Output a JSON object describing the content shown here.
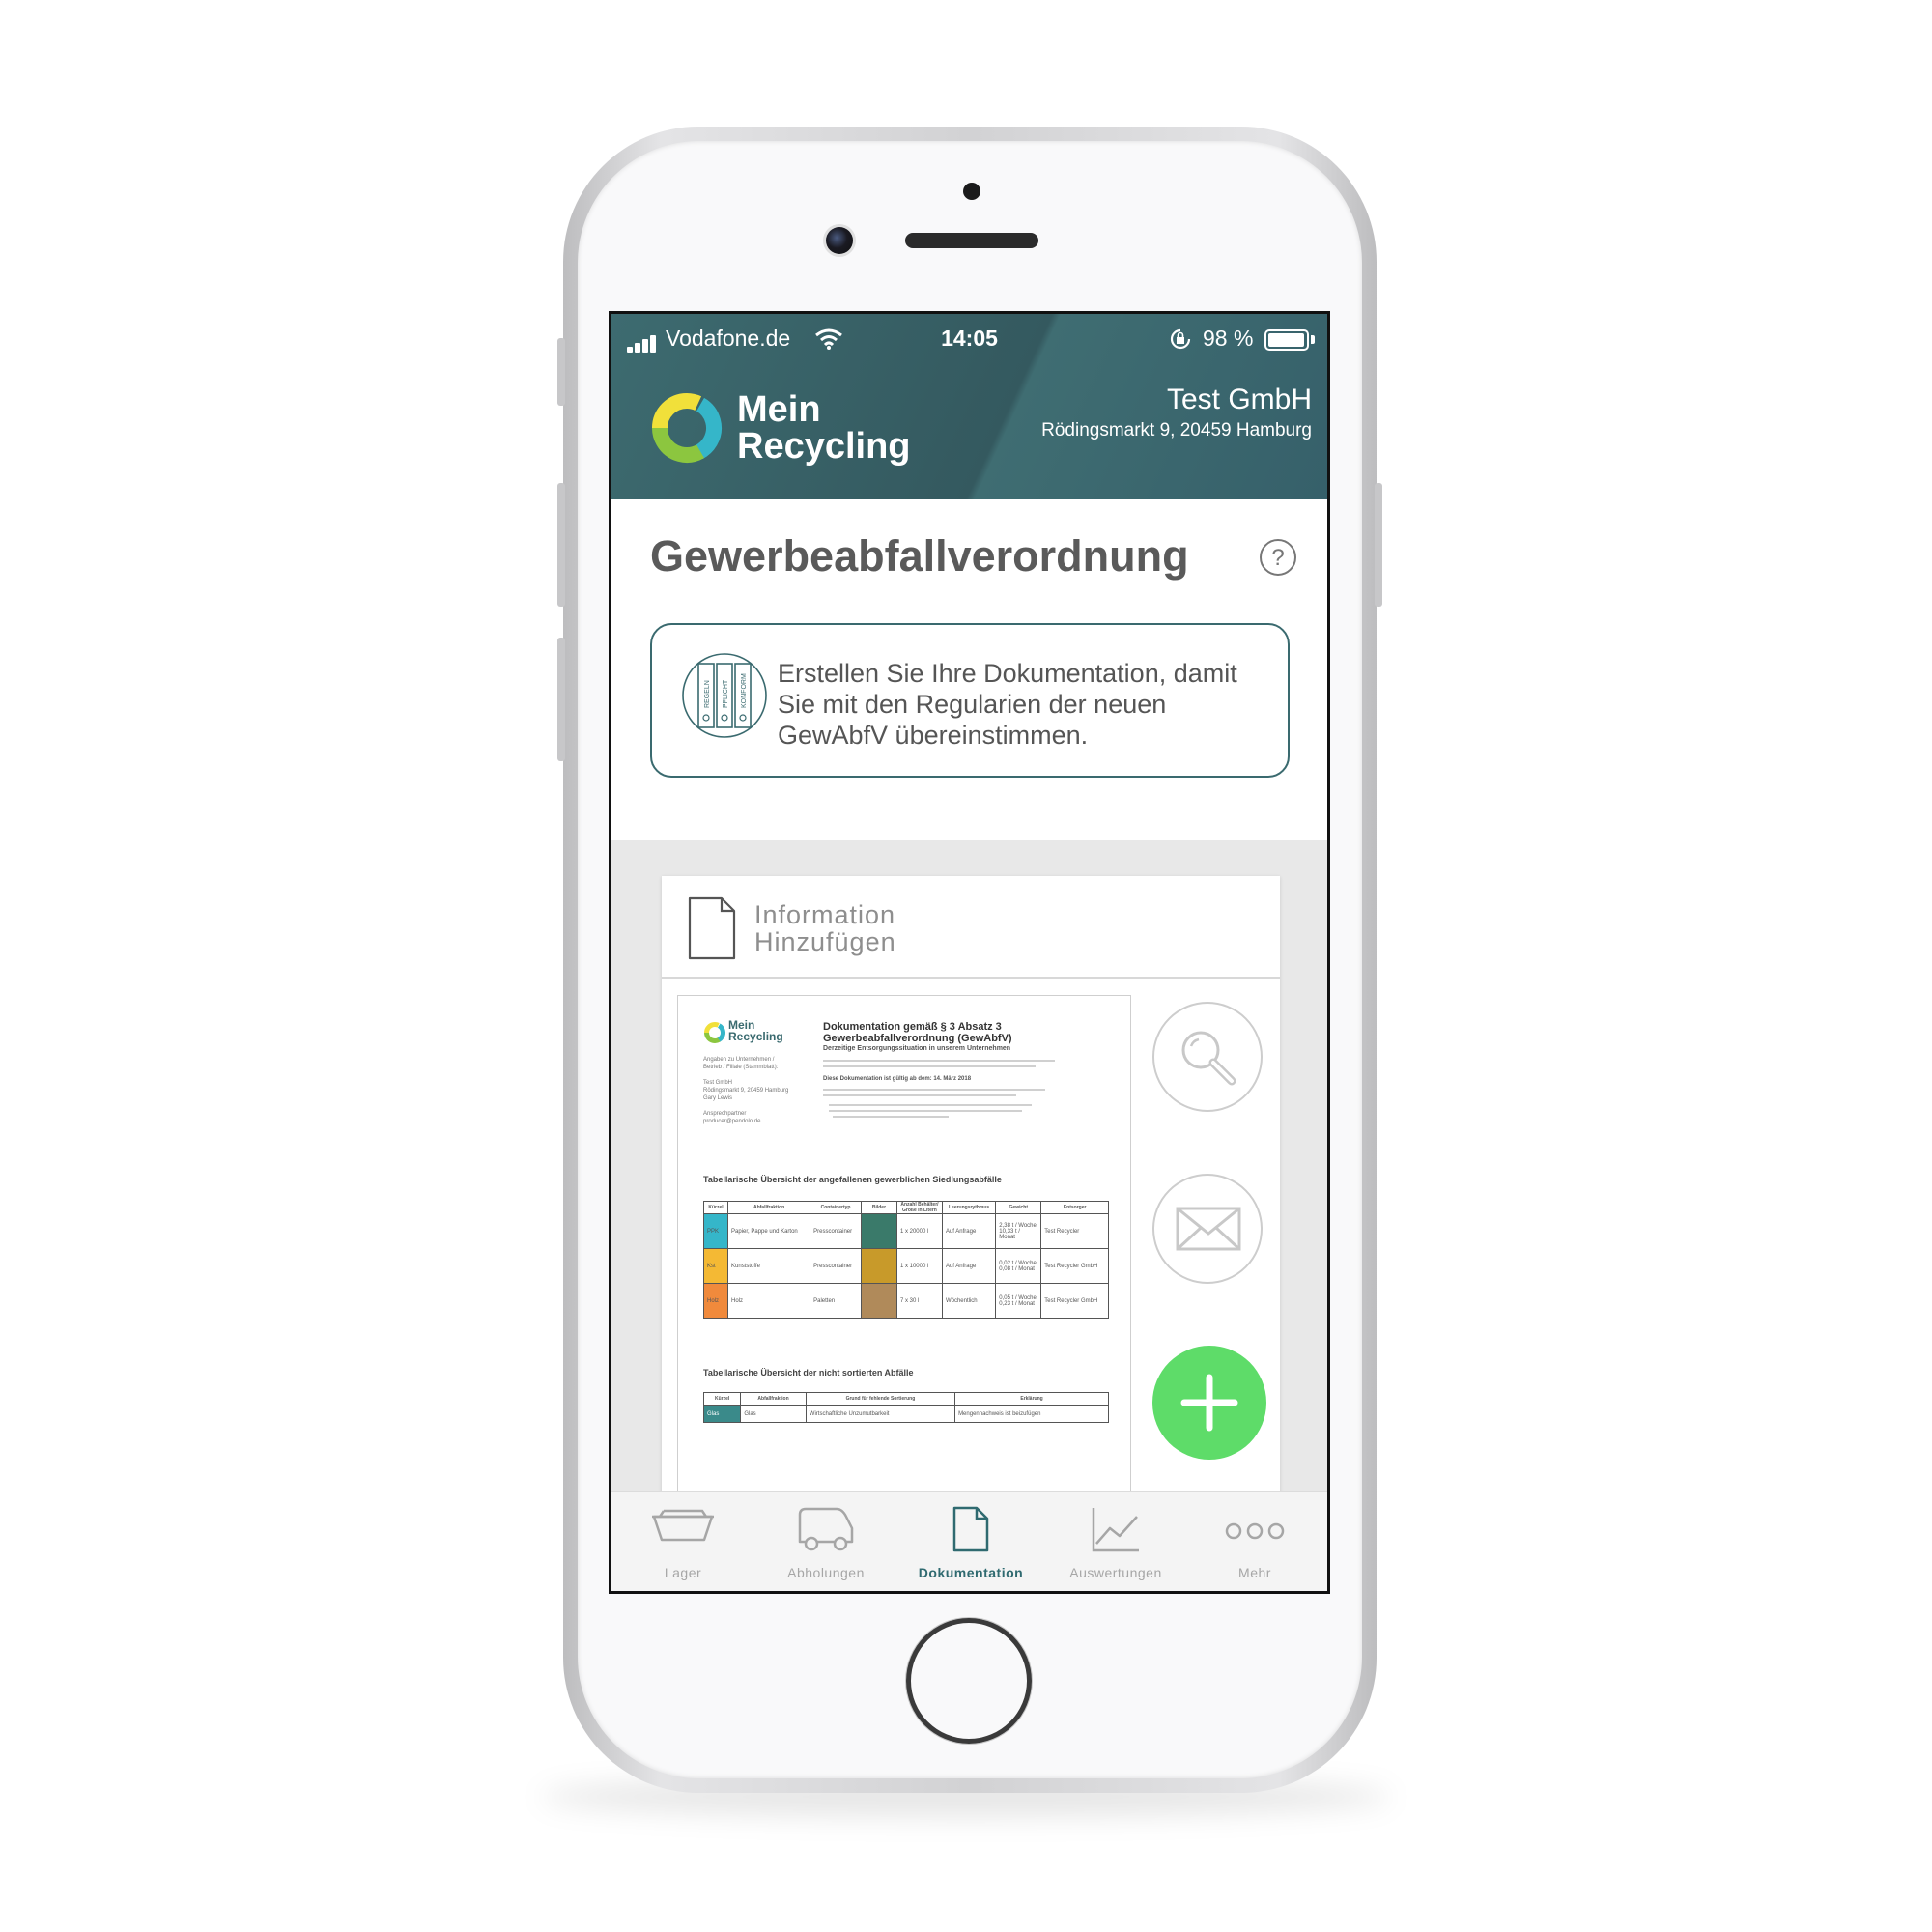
{
  "status_bar": {
    "carrier": "Vodafone.de",
    "time": "14:05",
    "battery_percent": "98 %",
    "battery_level": 0.98
  },
  "header": {
    "brand_line1": "Mein",
    "brand_line2": "Recycling",
    "company_name": "Test GmbH",
    "company_address": "Rödingsmarkt 9, 20459 Hamburg"
  },
  "page": {
    "title": "Gewerbeabfallverordnung"
  },
  "banner": {
    "text": "Erstellen Sie Ihre Dokumentation, damit Sie mit den Regularien der neuen GewAbfV übereinstimmen.",
    "binder_labels": [
      "REGELN",
      "PFLICHT",
      "KONFORM"
    ]
  },
  "document_card": {
    "title_line1": "Information",
    "title_line2": "Hinzufügen",
    "preview": {
      "logo_line1": "Mein",
      "logo_line2": "Recycling",
      "heading_line1": "Dokumentation gemäß § 3 Absatz 3",
      "heading_line2": "Gewerbeabfallverordnung (GewAbfV)",
      "subheading": "Derzeitige Entsorgungssituation in unserem Unternehmen",
      "left_block": [
        "Angaben zu Unternehmen /",
        "Betrieb / Filiale (Stammblatt):",
        "",
        "Test GmbH",
        "Rödingsmarkt 9, 20459 Hamburg",
        "Gary Lewis",
        "",
        "Ansprechpartner",
        "producer@pendolo.de"
      ],
      "validity": "Diese Dokumentation ist gültig ab dem: 14. März 2018",
      "section1_title": "Tabellarische Übersicht der angefallenen gewerblichen Siedlungsabfälle",
      "table1_headers": [
        "Kürzel",
        "Abfallfraktion",
        "Containertyp",
        "Bilder",
        "Anzahl Behälter/ Größe in Litern",
        "Leerungsrythmus",
        "Gewicht",
        "Entsorger"
      ],
      "table1_rows": [
        {
          "code": "PPK",
          "fraction": "Papier, Pappe und Karton",
          "container": "Presscontainer",
          "count": "1 x 20000 l",
          "rhythm": "Auf Anfrage",
          "weight": "2,38 t / Woche 10,33 t / Monat",
          "disposer": "Test Recycler",
          "color": "#35b6c9"
        },
        {
          "code": "Kst",
          "fraction": "Kunststoffe",
          "container": "Presscontainer",
          "count": "1 x 10000 l",
          "rhythm": "Auf Anfrage",
          "weight": "0,02 t / Woche 0,08 t / Monat",
          "disposer": "Test Recycler GmbH",
          "color": "#f4b934"
        },
        {
          "code": "Holz",
          "fraction": "Holz",
          "container": "Paletten",
          "count": "7 x 30 l",
          "rhythm": "Wöchentlich",
          "weight": "0,05 t / Woche 0,23 t / Monat",
          "disposer": "Test Recycler GmbH",
          "color": "#f08a3c"
        }
      ],
      "section2_title": "Tabellarische Übersicht der nicht sortierten Abfälle",
      "table2_headers": [
        "Kürzel",
        "Abfallfraktion",
        "Grund für fehlende Sortierung",
        "Erklärung"
      ],
      "table2_rows": [
        {
          "code": "Glas",
          "fraction": "Glas",
          "reason": "Wirtschaftliche Unzumutbarkeit",
          "explanation": "Mengennachweis ist beizufügen",
          "color": "#3a8a8a"
        }
      ]
    }
  },
  "tabs": [
    {
      "label": "Lager",
      "icon": "container-icon"
    },
    {
      "label": "Abholungen",
      "icon": "truck-icon"
    },
    {
      "label": "Dokumentation",
      "icon": "document-icon",
      "active": true
    },
    {
      "label": "Auswertungen",
      "icon": "chart-icon"
    },
    {
      "label": "Mehr",
      "icon": "more-icon"
    }
  ],
  "colors": {
    "header_teal": "#3a6368",
    "accent_teal": "#2f6a70",
    "add_green": "#5edc69",
    "page_title_gray": "#5a5a5a"
  }
}
